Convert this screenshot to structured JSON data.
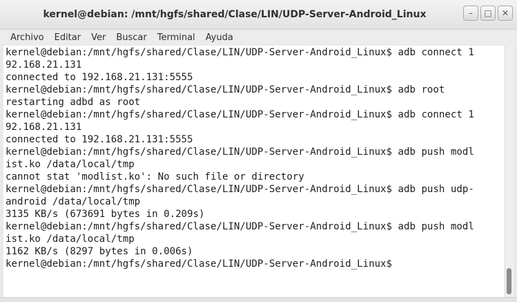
{
  "window": {
    "title": "kernel@debian: /mnt/hgfs/shared/Clase/LIN/UDP-Server-Android_Linux",
    "controls": {
      "minimize": "–",
      "maximize": "□",
      "close": "✕"
    }
  },
  "menu": [
    "Archivo",
    "Editar",
    "Ver",
    "Buscar",
    "Terminal",
    "Ayuda"
  ],
  "terminal": {
    "lines": [
      "kernel@debian:/mnt/hgfs/shared/Clase/LIN/UDP-Server-Android_Linux$ adb connect 1",
      "92.168.21.131",
      "connected to 192.168.21.131:5555",
      "kernel@debian:/mnt/hgfs/shared/Clase/LIN/UDP-Server-Android_Linux$ adb root",
      "restarting adbd as root",
      "kernel@debian:/mnt/hgfs/shared/Clase/LIN/UDP-Server-Android_Linux$ adb connect 1",
      "92.168.21.131",
      "connected to 192.168.21.131:5555",
      "kernel@debian:/mnt/hgfs/shared/Clase/LIN/UDP-Server-Android_Linux$ adb push modl",
      "ist.ko /data/local/tmp",
      "cannot stat 'modlist.ko': No such file or directory",
      "kernel@debian:/mnt/hgfs/shared/Clase/LIN/UDP-Server-Android_Linux$ adb push udp-",
      "android /data/local/tmp",
      "3135 KB/s (673691 bytes in 0.209s)",
      "kernel@debian:/mnt/hgfs/shared/Clase/LIN/UDP-Server-Android_Linux$ adb push modl",
      "ist.ko /data/local/tmp",
      "1162 KB/s (8297 bytes in 0.006s)",
      "kernel@debian:/mnt/hgfs/shared/Clase/LIN/UDP-Server-Android_Linux$"
    ]
  },
  "scrollbar": {
    "position_fraction": 1.0
  }
}
